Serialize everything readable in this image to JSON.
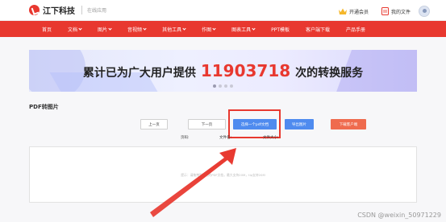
{
  "header": {
    "logo_text": "江下科技",
    "logo_sub": "在线应用",
    "vip_label": "开通会员",
    "files_label": "我的文件"
  },
  "nav": {
    "items": [
      {
        "label": "首页",
        "dropdown": false
      },
      {
        "label": "文档",
        "dropdown": true
      },
      {
        "label": "图片",
        "dropdown": true
      },
      {
        "label": "音视频",
        "dropdown": true
      },
      {
        "label": "其他工具",
        "dropdown": true
      },
      {
        "label": "作图",
        "dropdown": true
      },
      {
        "label": "图表工具",
        "dropdown": true
      },
      {
        "label": "PPT模板",
        "dropdown": false
      },
      {
        "label": "客户端下载",
        "dropdown": false
      },
      {
        "label": "产品手册",
        "dropdown": false
      }
    ]
  },
  "banner": {
    "text_before": "累计已为广大用户提供",
    "number": "11903718",
    "text_after": "次的转换服务",
    "slides": 4,
    "active_slide": 0
  },
  "tool": {
    "title": "PDF转图片",
    "prev_label": "上一页",
    "next_label": "下一页",
    "choose_label": "选择一个pdf文档",
    "export_label": "导出图片",
    "download_label": "下载客户端",
    "pages_label": "页码:",
    "filename_label": "文件名:",
    "filesize_label": "文件大小:",
    "drop_hint": "提示：请拖拽到此处的PDF文档，最大支持20M，tip支持20M"
  },
  "watermark": "CSDN @weixin_50971229",
  "colors": {
    "brand_red": "#e8382f",
    "button_blue": "#4f8bef",
    "button_orange": "#ef6b4e"
  }
}
